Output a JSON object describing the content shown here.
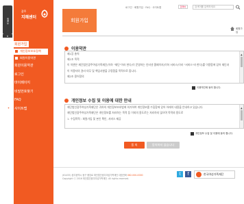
{
  "quick_menu": {
    "label": "퀵메뉴",
    "arrow": "∧"
  },
  "logo": {
    "small": "광주",
    "big": "지혜센터"
  },
  "sidebar": {
    "items": [
      {
        "label": "회원가입",
        "icon": "user-icon",
        "active": true
      },
      {
        "label": "회원이용약관",
        "icon": "document-icon"
      },
      {
        "label": "로그인",
        "icon": "power-icon"
      },
      {
        "label": "마이페이지",
        "icon": "magnifier-icon"
      },
      {
        "label": "비밀번호찾기",
        "icon": "key-icon"
      },
      {
        "label": "FAQ",
        "icon": "chat-icon"
      },
      {
        "label": "사이트맵",
        "icon": "map-pin-icon"
      }
    ],
    "subs": [
      {
        "label": "개인정보보호정책",
        "selected": true
      },
      {
        "label": "회원이용약관"
      }
    ]
  },
  "topnav": {
    "text": "로그인 · 회원가입 · FAQ · 사이트맵"
  },
  "lang": {
    "label": "한국어"
  },
  "search": {
    "placeholder": "검색어를 입력하세요"
  },
  "page": {
    "title": "회원가입",
    "breadcrumb": "회원가입"
  },
  "terms": {
    "title": "이용약관",
    "lines": [
      "제1장 총칙",
      "제1조 목적",
      "이 약관은 재단법인광주여성가족재단(이하 \"재단\"이라 한다)이 운영하는 인터넷 홈페이지(이하 서비스)이라 \"서비스\"라 한다)를 이용함에 있어 재단과",
      "이 이용자의 권리·의무 및 책임사항을 규정함을 목적으로 합니다.",
      "제2조 용어정의"
    ],
    "agree": "이용약관에 동의 합니다."
  },
  "privacy": {
    "title": "개인정보 수집 및 이용에 대한 안내",
    "lines": [
      "재단법인광주여성가족재단은 귀하의 개인정보보호법에 의거하여 개인정보를 수집함에 있어 아래의 내용을 안내하고 있습니다.",
      "재단법인광주여성가족재단은 개인정보를 처리하는 목적 등 이외의 용도로는 처리하지 않으며 목적외 용도로",
      "1. 수집목적 : 회원가입 및 본인 확인, 서비스 제공"
    ],
    "agree": "개인정보 수집 및 이용에 동의 합니다."
  },
  "buttons": {
    "ok": "동 의",
    "no": "동의하지 않습니다"
  },
  "footer": {
    "address": "(61455) 광주광역시 동구 중앙로 재단법인광주여성가족재단 대표전화",
    "phone": "062-000-0000",
    "copyright": "Copyright ⓒ 2016 재단법인광주여성가족재단. All rights reserved."
  },
  "partner": {
    "label": "한국여성가족재단"
  },
  "colors": {
    "accent": "#f15a22",
    "sidebar": "#f15a22"
  }
}
